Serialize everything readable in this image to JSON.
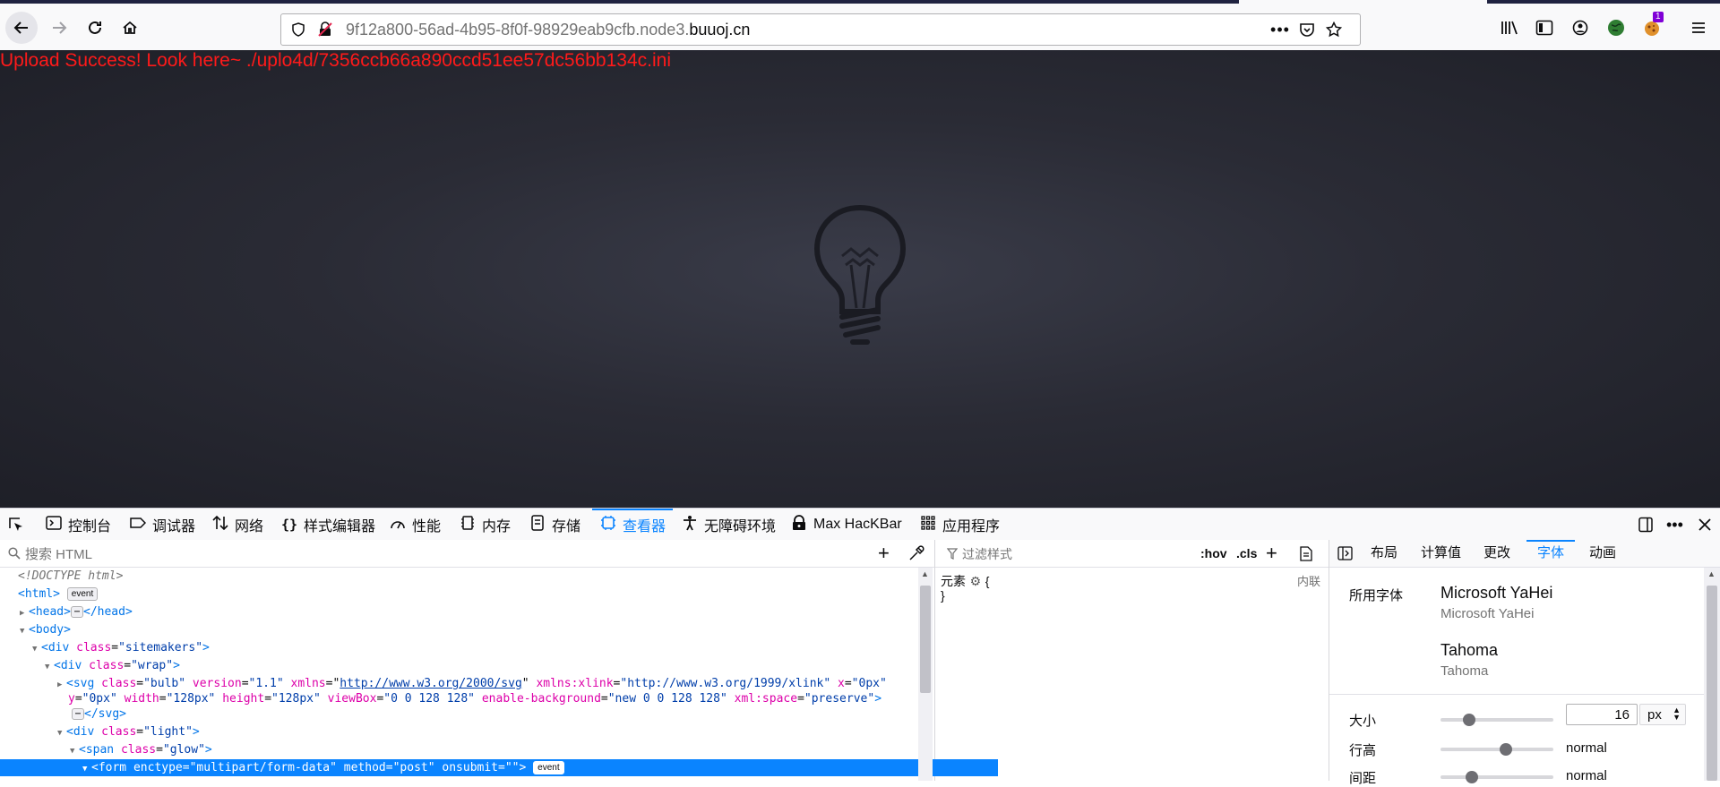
{
  "browser": {
    "url_prefix": "9f12a800-56ad-4b95-8f0f-98929eab9cfb.node3.",
    "url_domain": "buuoj.cn",
    "extension_badge": "1"
  },
  "page": {
    "upload_message": "Upload Success! Look here~ ./uplo4d/7356ccb66a890ccd51ee57dc56bb134c.ini"
  },
  "devtools": {
    "tabs": [
      {
        "label": "控制台",
        "icon": "console-icon"
      },
      {
        "label": "调试器",
        "icon": "debugger-icon"
      },
      {
        "label": "网络",
        "icon": "network-icon"
      },
      {
        "label": "样式编辑器",
        "icon": "style-editor-icon"
      },
      {
        "label": "性能",
        "icon": "performance-icon"
      },
      {
        "label": "内存",
        "icon": "memory-icon"
      },
      {
        "label": "存储",
        "icon": "storage-icon"
      },
      {
        "label": "查看器",
        "icon": "inspector-icon"
      },
      {
        "label": "无障碍环境",
        "icon": "accessibility-icon"
      },
      {
        "label": "Max HacKBar",
        "icon": "hackbar-icon"
      },
      {
        "label": "应用程序",
        "icon": "application-icon"
      }
    ],
    "active_tab": "查看器",
    "html_search_placeholder": "搜索 HTML",
    "markup": {
      "doctype": "<!DOCTYPE html>",
      "html_open": "<html>",
      "event_badge": "event",
      "head_open": "<head>",
      "head_close": "</head>",
      "body_open": "<body>",
      "div_sitemakers_tag": "div",
      "div_sitemakers_attr": "class",
      "div_sitemakers_val": "\"sitemakers\"",
      "div_wrap_val": "\"wrap\"",
      "svg_line1_tag": "svg",
      "svg_attrs": [
        {
          "name": "class",
          "value": "\"bulb\""
        },
        {
          "name": "version",
          "value": "\"1.1\""
        },
        {
          "name": "xmlns",
          "value": "http://www.w3.org/2000/svg"
        },
        {
          "name": "xmlns:xlink",
          "value": "\"http://www.w3.org/1999/xlink\""
        },
        {
          "name": "x",
          "value": "\"0px\""
        }
      ],
      "svg_line2": [
        {
          "name": "y",
          "value": "\"0px\""
        },
        {
          "name": "width",
          "value": "\"128px\""
        },
        {
          "name": "height",
          "value": "\"128px\""
        },
        {
          "name": "viewBox",
          "value": "\"0 0 128 128\""
        },
        {
          "name": "enable-background",
          "value": "\"new 0 0 128 128\""
        },
        {
          "name": "xml:space",
          "value": "\"preserve\""
        }
      ],
      "svg_close": "</svg>",
      "div_light_val": "\"light\"",
      "span_glow_val": "\"glow\"",
      "form_tag": "form",
      "form_attrs": [
        {
          "name": "enctype",
          "value": "\"multipart/form-data\""
        },
        {
          "name": "method",
          "value": "\"post\""
        },
        {
          "name": "onsubmit",
          "value": "\"\""
        }
      ]
    },
    "rules": {
      "filter_placeholder": "过滤样式",
      "hov": ":hov",
      "cls": ".cls",
      "element_label": "元素",
      "open_brace": "{",
      "close_brace": "}",
      "inline_label": "内联"
    },
    "side_tabs": [
      "布局",
      "计算值",
      "更改",
      "字体",
      "动画"
    ],
    "side_active": "字体",
    "fonts": {
      "used_label": "所用字体",
      "font1_name": "Microsoft YaHei",
      "font1_sub": "Microsoft YaHei",
      "font2_name": "Tahoma",
      "font2_sub": "Tahoma",
      "size_label": "大小",
      "size_value": "16",
      "size_unit": "px",
      "size_level": 0.25,
      "line_height_label": "行高",
      "line_height_value": "normal",
      "line_height_level": 0.58,
      "spacing_label": "间距",
      "spacing_value": "normal",
      "spacing_level": 0.28
    }
  }
}
